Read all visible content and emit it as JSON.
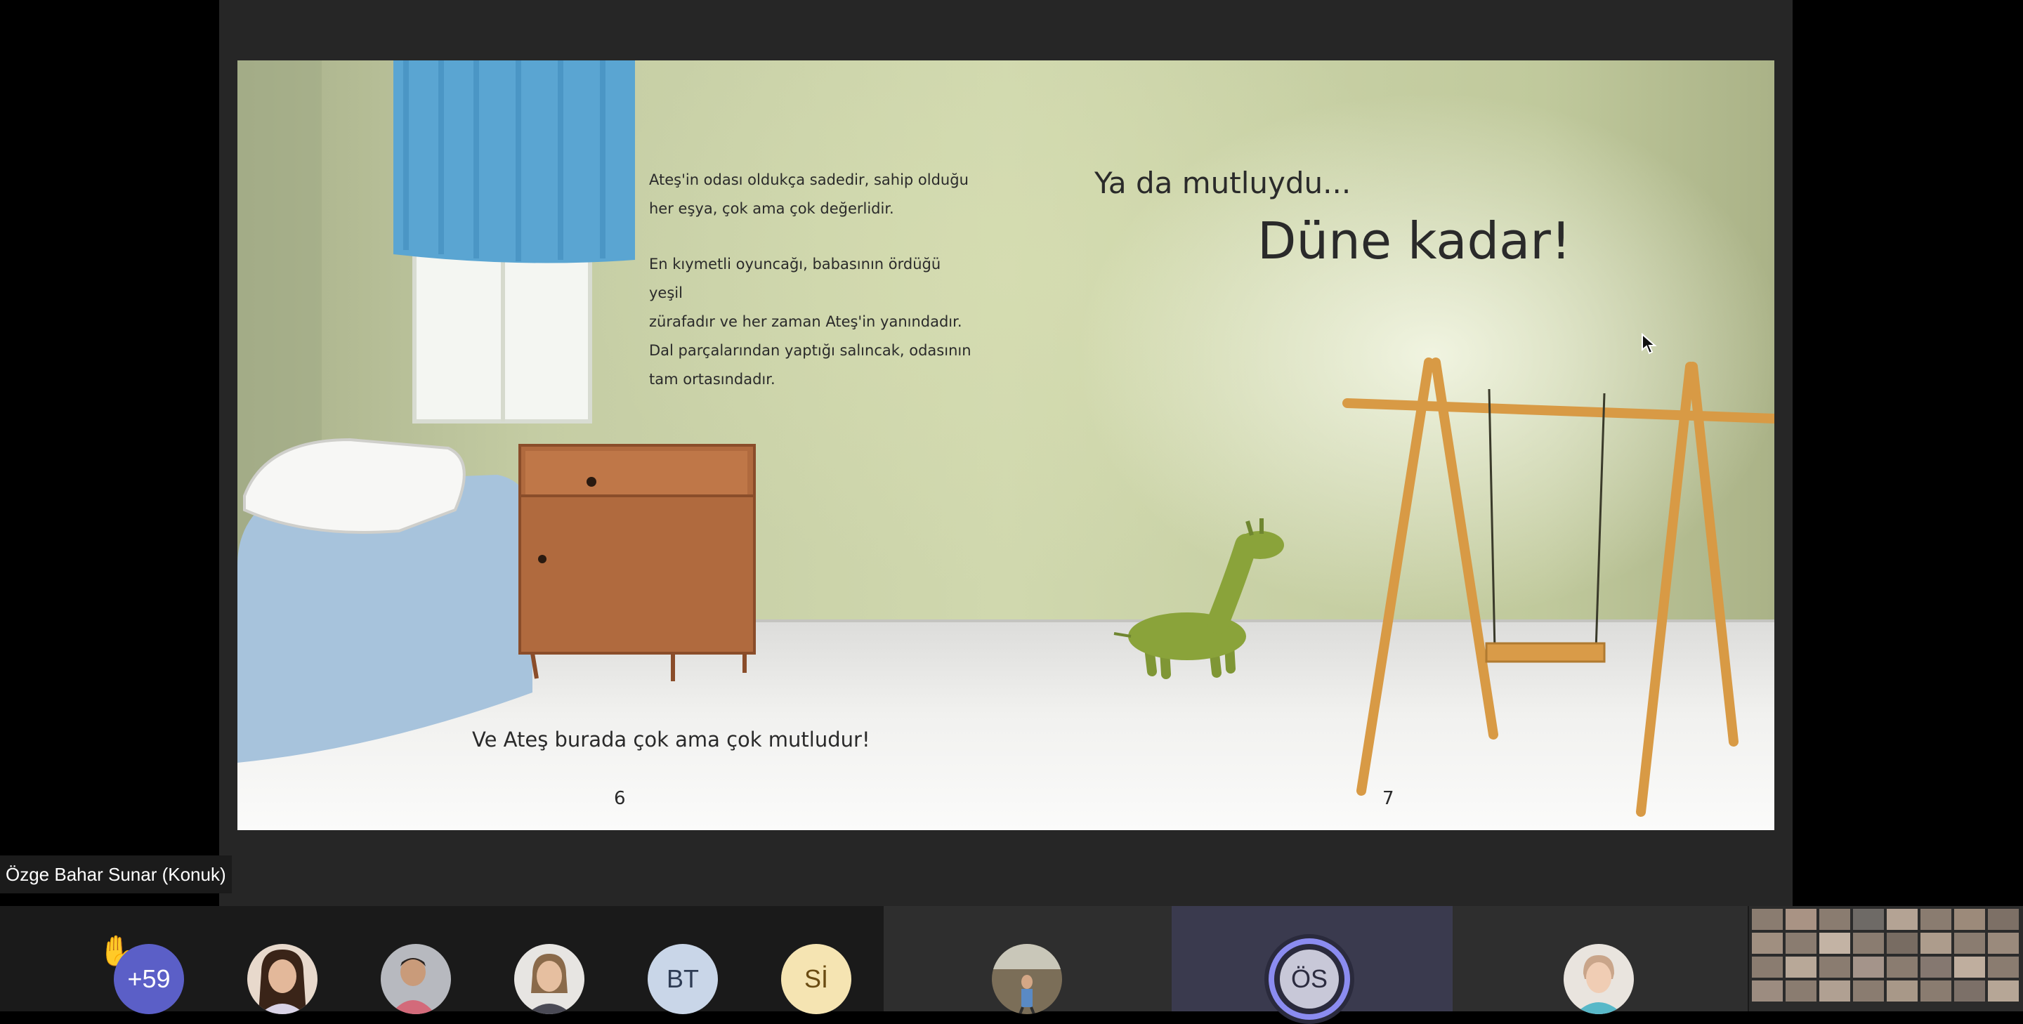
{
  "presenter": {
    "name": "Özge Bahar Sunar (Konuk)"
  },
  "book_pages": {
    "left": {
      "paragraph_1": [
        "Ateş'in odası oldukça sadedir, sahip olduğu",
        "her eşya, çok ama çok değerlidir."
      ],
      "paragraph_2": [
        "En kıymetli oyuncağı, babasının ördüğü yeşil",
        "zürafadır ve her zaman Ateş'in yanındadır.",
        "Dal parçalarından yaptığı salıncak, odasının",
        "tam ortasındadır."
      ],
      "bottom_line": "Ve Ateş burada çok ama çok mutludur!",
      "page_number": "6"
    },
    "right": {
      "heading_1": "Ya da mutluydu...",
      "heading_2": "Düne kadar!",
      "page_number": "7"
    }
  },
  "participants_bar": {
    "overflow_count": "+59",
    "avatars": [
      {
        "type": "initials",
        "initials": "BT",
        "color": "#c9d6e8",
        "text_color": "#2e3c54"
      },
      {
        "type": "initials",
        "initials": "Sİ",
        "color": "#f5e4b2",
        "text_color": "#6a4b12"
      },
      {
        "type": "initials",
        "initials": "ÖS",
        "color": "#c8c8d8",
        "text_color": "#2c2c40",
        "speaking": true
      }
    ]
  },
  "colors": {
    "overflow_badge": "#5b5fc7",
    "speaking_ring": "#8b8cf0",
    "wall": "#c5cda4",
    "dresser": "#b06a3e",
    "swing_wood": "#d89a45",
    "giraffe": "#8aa33a"
  }
}
